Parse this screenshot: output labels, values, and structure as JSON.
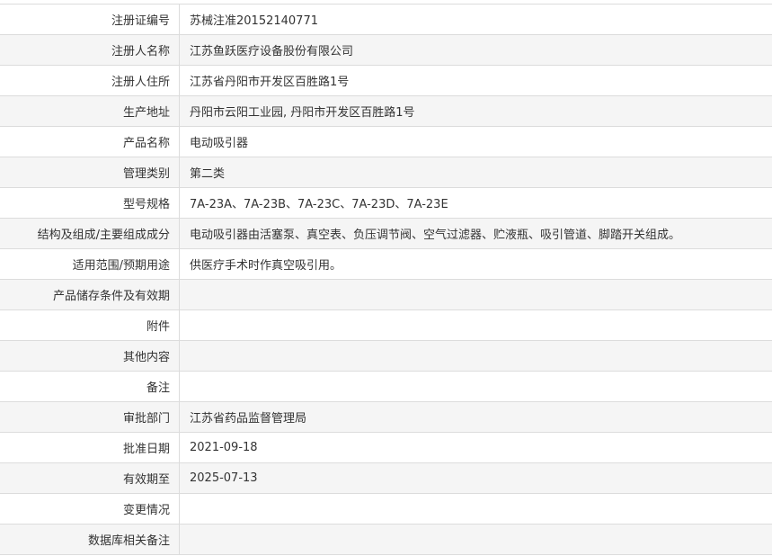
{
  "rows": [
    {
      "label": "注册证编号",
      "value": "苏械注准20152140771"
    },
    {
      "label": "注册人名称",
      "value": "江苏鱼跃医疗设备股份有限公司"
    },
    {
      "label": "注册人住所",
      "value": "江苏省丹阳市开发区百胜路1号"
    },
    {
      "label": "生产地址",
      "value": "丹阳市云阳工业园, 丹阳市开发区百胜路1号"
    },
    {
      "label": "产品名称",
      "value": "电动吸引器"
    },
    {
      "label": "管理类别",
      "value": "第二类"
    },
    {
      "label": "型号规格",
      "value": "7A-23A、7A-23B、7A-23C、7A-23D、7A-23E"
    },
    {
      "label": "结构及组成/主要组成成分",
      "value": "电动吸引器由活塞泵、真空表、负压调节阀、空气过滤器、贮液瓶、吸引管道、脚踏开关组成。"
    },
    {
      "label": "适用范围/预期用途",
      "value": "供医疗手术时作真空吸引用。"
    },
    {
      "label": "产品储存条件及有效期",
      "value": ""
    },
    {
      "label": "附件",
      "value": ""
    },
    {
      "label": "其他内容",
      "value": ""
    },
    {
      "label": "备注",
      "value": ""
    },
    {
      "label": "审批部门",
      "value": "江苏省药品监督管理局"
    },
    {
      "label": "批准日期",
      "value": "2021-09-18"
    },
    {
      "label": "有效期至",
      "value": "2025-07-13"
    },
    {
      "label": "变更情况",
      "value": ""
    },
    {
      "label": "数据库相关备注",
      "value": ""
    }
  ]
}
